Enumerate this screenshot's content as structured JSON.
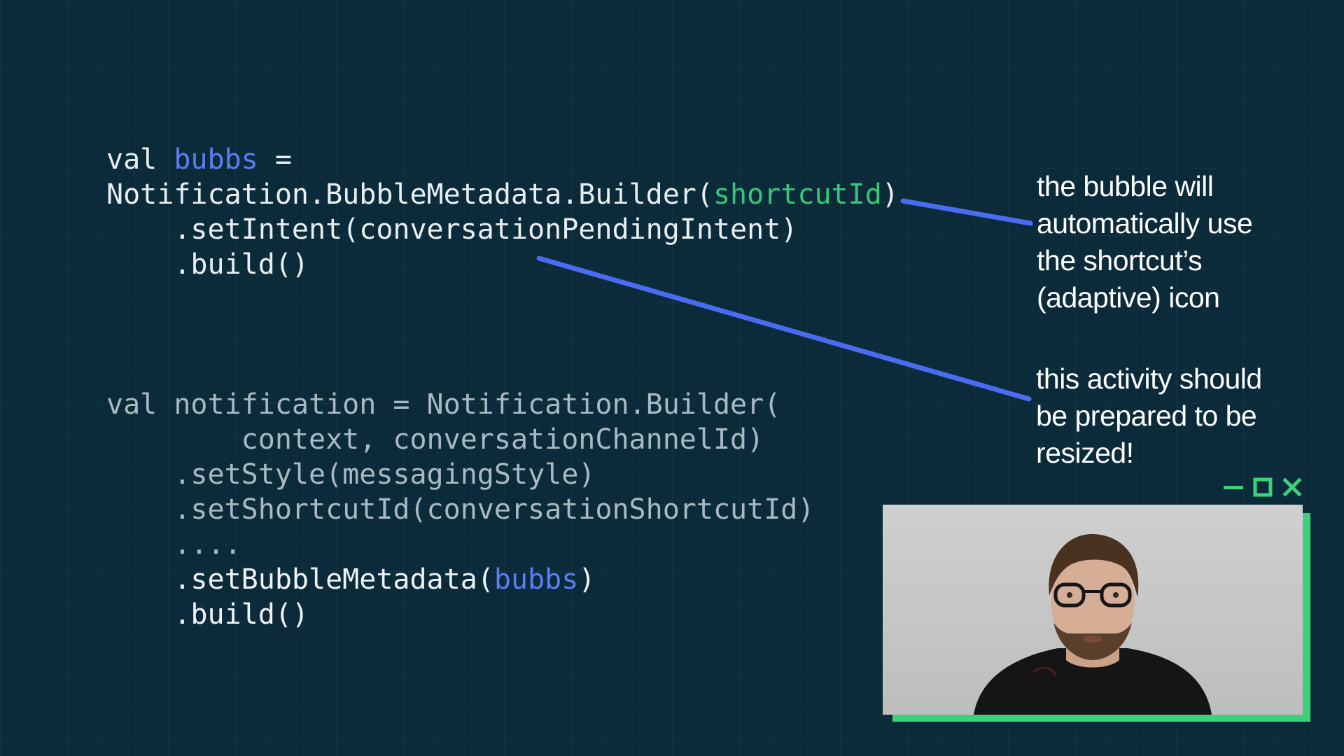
{
  "slide": {
    "code_block_1": {
      "line1": {
        "kw": "val ",
        "var": "bubbs",
        "rest": " ="
      },
      "line2": {
        "prefix": "Notification.BubbleMetadata.Builder(",
        "arg": "shortcutId",
        "suffix": ")"
      },
      "line3": "    .setIntent(conversationPendingIntent)",
      "line4": "    .build()"
    },
    "code_block_2": {
      "line1": "val notification = Notification.Builder(",
      "line2": "        context, conversationChannelId)",
      "line3": "    .setStyle(messagingStyle)",
      "line4": "    .setShortcutId(conversationShortcutId)",
      "line5": "    ....",
      "line6": {
        "prefix": "    .setBubbleMetadata(",
        "arg": "bubbs",
        "suffix": ")"
      },
      "line7": "    .build()"
    },
    "annotations": {
      "note_1": [
        "the bubble will",
        "automatically use",
        "the shortcut’s",
        "(adaptive) icon"
      ],
      "note_2": [
        "this activity should",
        "be prepared to be",
        "resized!"
      ]
    }
  },
  "pip_window": {
    "controls": [
      "minimize-icon",
      "maximize-icon",
      "close-icon"
    ],
    "accent_color": "#3dd07b"
  },
  "colors": {
    "background": "#0b2b3b",
    "highlight_blue": "#5c7df2",
    "highlight_green": "#37c776",
    "arrow": "#4a6cf0"
  }
}
